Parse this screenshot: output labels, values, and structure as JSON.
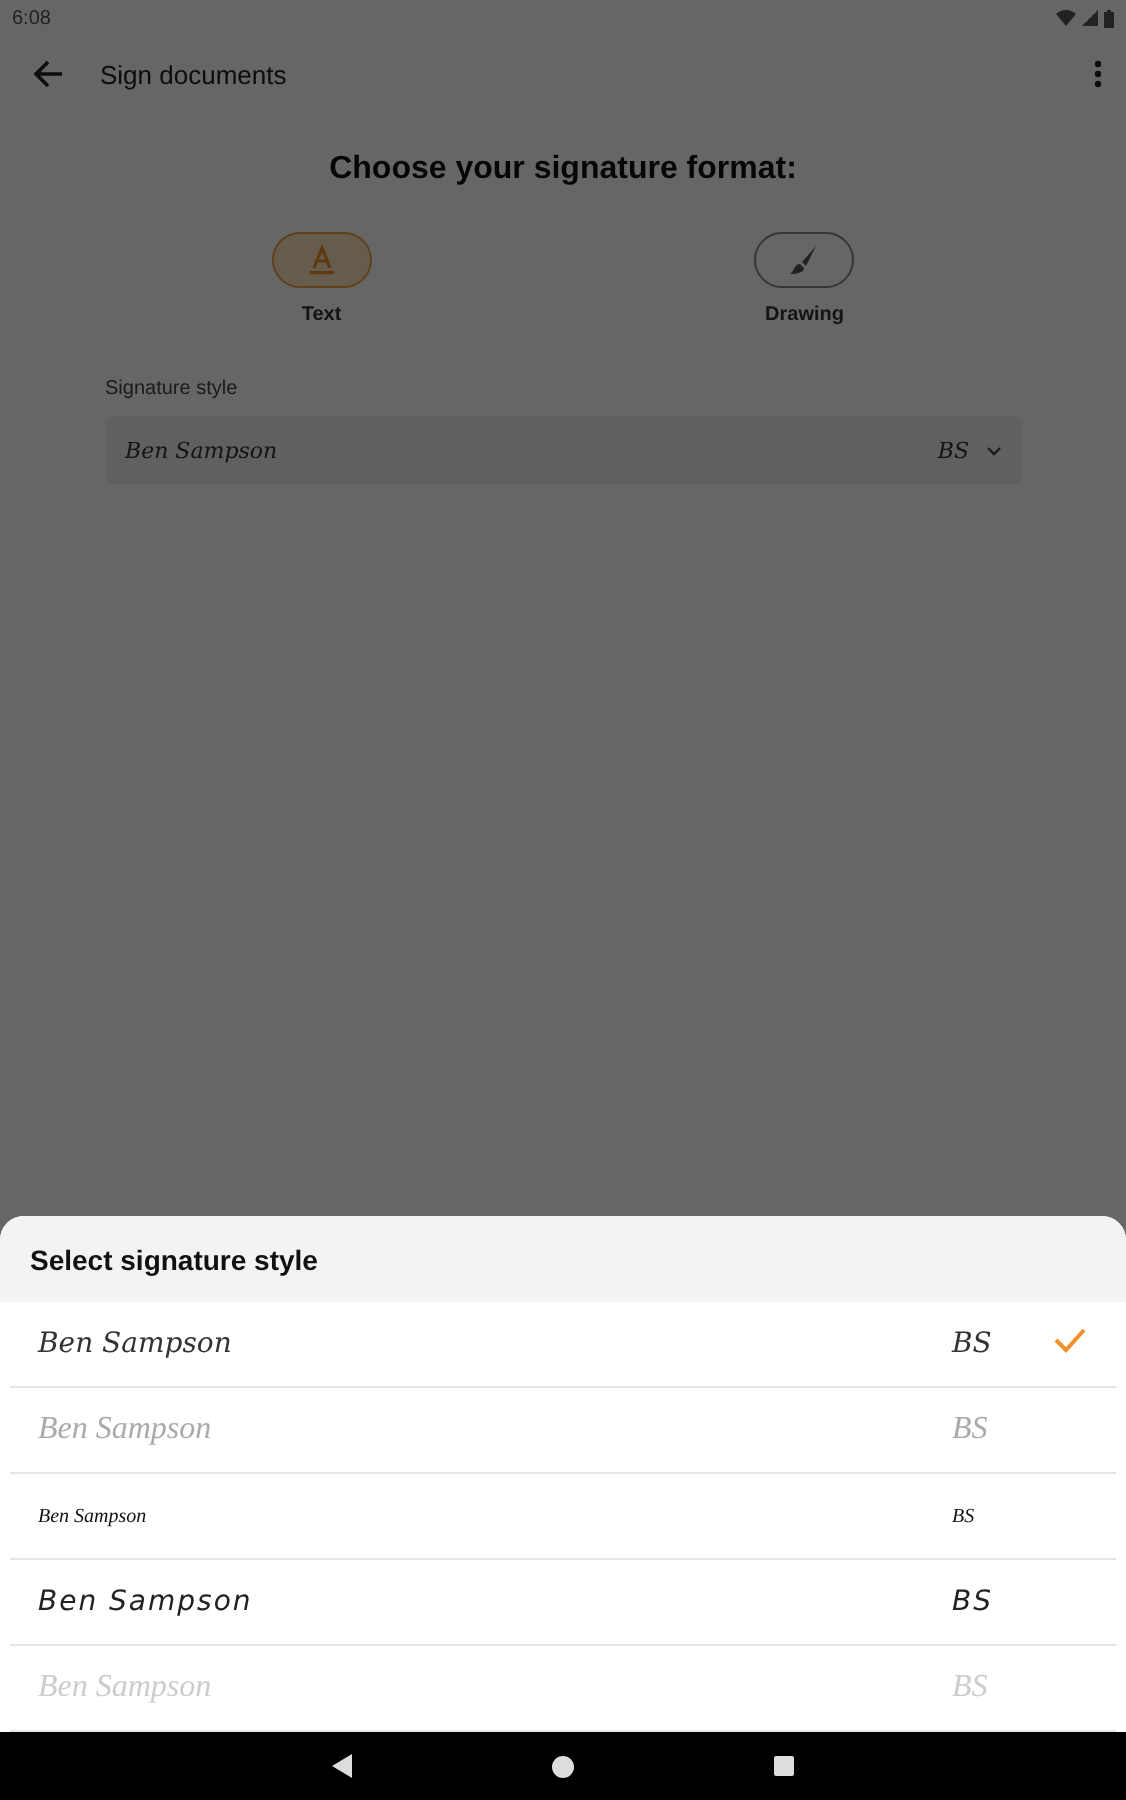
{
  "status_bar": {
    "time": "6:08"
  },
  "toolbar": {
    "title": "Sign documents"
  },
  "heading": "Choose your signature format:",
  "formats": [
    {
      "kind": "text",
      "label": "Text",
      "selected": true
    },
    {
      "kind": "drawing",
      "label": "Drawing",
      "selected": false
    }
  ],
  "style_field": {
    "label": "Signature style",
    "value": "Ben Sampson",
    "initials": "BS"
  },
  "sheet": {
    "title": "Select signature style",
    "options": [
      {
        "kind": "script",
        "name": "Ben Sampson",
        "initials": "BS",
        "selected": true
      },
      {
        "kind": "faint",
        "name": "Ben Sampson",
        "initials": "BS",
        "selected": false
      },
      {
        "kind": "small",
        "name": "Ben Sampson",
        "initials": "BS",
        "selected": false
      },
      {
        "kind": "slanted",
        "name": "Ben Sampson",
        "initials": "BS",
        "selected": false
      },
      {
        "kind": "pale",
        "name": "Ben Sampson",
        "initials": "BS",
        "selected": false
      }
    ]
  }
}
